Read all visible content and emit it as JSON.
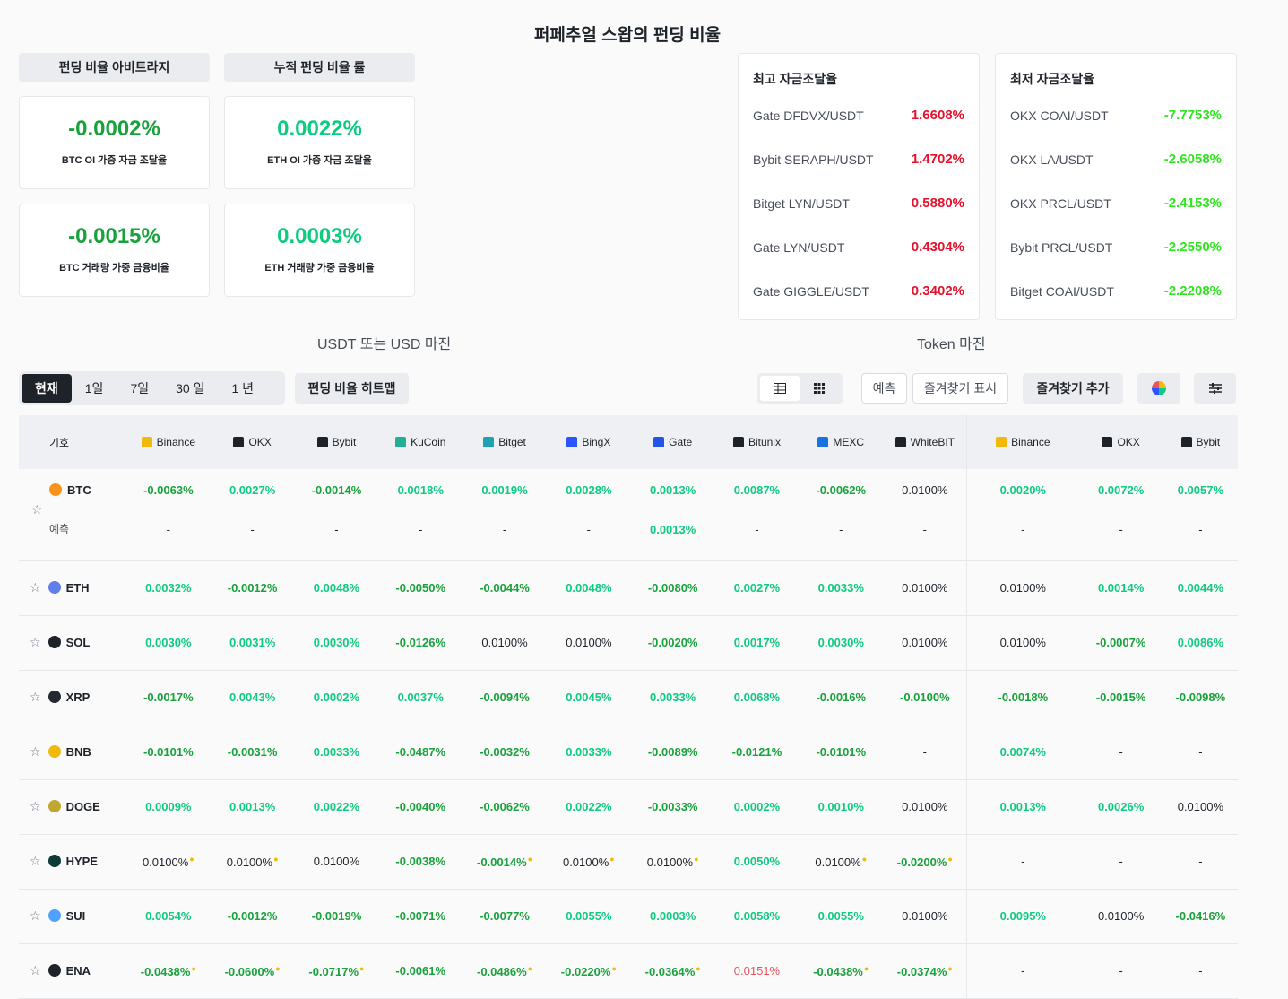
{
  "page_title": "퍼페추얼 스왑의 펀딩 비율",
  "tabs": {
    "arbitrage": "펀딩 비율 아비트라지",
    "cumulative": "누적 펀딩 비율 률"
  },
  "kpis": [
    {
      "value": "-0.0002%",
      "label": "BTC OI 가중 자금 조달율",
      "color": "#18a23c"
    },
    {
      "value": "0.0022%",
      "label": "ETH OI 가중 자금 조달율",
      "color": "#0ecb81"
    },
    {
      "value": "-0.0015%",
      "label": "BTC 거래량 가중 금융비율",
      "color": "#18a23c"
    },
    {
      "value": "0.0003%",
      "label": "ETH 거래량 가중 금융비율",
      "color": "#0ecb81"
    }
  ],
  "highest": {
    "title": "최고 자금조달율",
    "items": [
      {
        "pair": "Gate DFDVX/USDT",
        "value": "1.6608%"
      },
      {
        "pair": "Bybit SERAPH/USDT",
        "value": "1.4702%"
      },
      {
        "pair": "Bitget LYN/USDT",
        "value": "0.5880%"
      },
      {
        "pair": "Gate LYN/USDT",
        "value": "0.4304%"
      },
      {
        "pair": "Gate GIGGLE/USDT",
        "value": "0.3402%"
      }
    ]
  },
  "lowest": {
    "title": "최저 자금조달율",
    "items": [
      {
        "pair": "OKX COAI/USDT",
        "value": "-7.7753%"
      },
      {
        "pair": "OKX LA/USDT",
        "value": "-2.6058%"
      },
      {
        "pair": "OKX PRCL/USDT",
        "value": "-2.4153%"
      },
      {
        "pair": "Bybit PRCL/USDT",
        "value": "-2.2550%"
      },
      {
        "pair": "Bitget COAI/USDT",
        "value": "-2.2208%"
      }
    ]
  },
  "section_labels": {
    "usdt": "USDT 또는 USD 마진",
    "token": "Token 마진"
  },
  "periods": [
    "현재",
    "1일",
    "7일",
    "30 일",
    "1 년"
  ],
  "toolbar": {
    "heatmap": "펀딩 비율 히트맵",
    "predict": "예측",
    "show_fav": "즐겨찾기 표시",
    "add_fav": "즐겨찾기 추가"
  },
  "table": {
    "symbol_header": "기호",
    "exchanges": [
      {
        "name": "Binance",
        "icon": "binance-icon",
        "color": "#f0b90b"
      },
      {
        "name": "OKX",
        "icon": "okx-icon",
        "color": "#1e2329"
      },
      {
        "name": "Bybit",
        "icon": "bybit-icon",
        "color": "#1e2329"
      },
      {
        "name": "KuCoin",
        "icon": "kucoin-icon",
        "color": "#23af91"
      },
      {
        "name": "Bitget",
        "icon": "bitget-icon",
        "color": "#1da2b4"
      },
      {
        "name": "BingX",
        "icon": "bingx-icon",
        "color": "#2a54ff"
      },
      {
        "name": "Gate",
        "icon": "gate-icon",
        "color": "#2354e6"
      },
      {
        "name": "Bitunix",
        "icon": "bitunix-icon",
        "color": "#1e2329"
      },
      {
        "name": "MEXC",
        "icon": "mexc-icon",
        "color": "#1972e2"
      },
      {
        "name": "WhiteBIT",
        "icon": "whitebit-icon",
        "color": "#1e2329"
      },
      {
        "name": "Binance",
        "icon": "binance-icon",
        "color": "#f0b90b"
      },
      {
        "name": "OKX",
        "icon": "okx-icon",
        "color": "#1e2329"
      },
      {
        "name": "Bybit",
        "icon": "bybit-icon",
        "color": "#1e2329"
      }
    ],
    "predict_label": "예측",
    "btc_predict": [
      "-",
      "-",
      "-",
      "-",
      "-",
      "-",
      "0.0013%",
      "-",
      "-",
      "-",
      "-",
      "-",
      "-"
    ],
    "rows": [
      {
        "symbol": "BTC",
        "icon_color": "#f7931a",
        "values": [
          "-0.0063%",
          "0.0027%",
          "-0.0014%",
          "0.0018%",
          "0.0019%",
          "0.0028%",
          "0.0013%",
          "0.0087%",
          "-0.0062%",
          "0.0100%",
          "0.0020%",
          "0.0072%",
          "0.0057%"
        ],
        "dots": []
      },
      {
        "symbol": "ETH",
        "icon_color": "#627eea",
        "values": [
          "0.0032%",
          "-0.0012%",
          "0.0048%",
          "-0.0050%",
          "-0.0044%",
          "0.0048%",
          "-0.0080%",
          "0.0027%",
          "0.0033%",
          "0.0100%",
          "0.0100%",
          "0.0014%",
          "0.0044%"
        ],
        "dots": []
      },
      {
        "symbol": "SOL",
        "icon_color": "#1e2329",
        "values": [
          "0.0030%",
          "0.0031%",
          "0.0030%",
          "-0.0126%",
          "0.0100%",
          "0.0100%",
          "-0.0020%",
          "0.0017%",
          "0.0030%",
          "0.0100%",
          "0.0100%",
          "-0.0007%",
          "0.0086%"
        ],
        "dots": []
      },
      {
        "symbol": "XRP",
        "icon_color": "#23292f",
        "values": [
          "-0.0017%",
          "0.0043%",
          "0.0002%",
          "0.0037%",
          "-0.0094%",
          "0.0045%",
          "0.0033%",
          "0.0068%",
          "-0.0016%",
          "-0.0100%",
          "-0.0018%",
          "-0.0015%",
          "-0.0098%"
        ],
        "dots": []
      },
      {
        "symbol": "BNB",
        "icon_color": "#f0b90b",
        "values": [
          "-0.0101%",
          "-0.0031%",
          "0.0033%",
          "-0.0487%",
          "-0.0032%",
          "0.0033%",
          "-0.0089%",
          "-0.0121%",
          "-0.0101%",
          "-",
          "0.0074%",
          "-",
          "-"
        ],
        "dots": []
      },
      {
        "symbol": "DOGE",
        "icon_color": "#c2a633",
        "values": [
          "0.0009%",
          "0.0013%",
          "0.0022%",
          "-0.0040%",
          "-0.0062%",
          "0.0022%",
          "-0.0033%",
          "0.0002%",
          "0.0010%",
          "0.0100%",
          "0.0013%",
          "0.0026%",
          "0.0100%"
        ],
        "dots": []
      },
      {
        "symbol": "HYPE",
        "icon_color": "#0e3b36",
        "values": [
          "0.0100%",
          "0.0100%",
          "0.0100%",
          "-0.0038%",
          "-0.0014%",
          "0.0100%",
          "0.0100%",
          "0.0050%",
          "0.0100%",
          "-0.0200%",
          "-",
          "-",
          "-"
        ],
        "dots": [
          0,
          1,
          4,
          5,
          6,
          8,
          9
        ]
      },
      {
        "symbol": "SUI",
        "icon_color": "#4da2ff",
        "values": [
          "0.0054%",
          "-0.0012%",
          "-0.0019%",
          "-0.0071%",
          "-0.0077%",
          "0.0055%",
          "0.0003%",
          "0.0058%",
          "0.0055%",
          "0.0100%",
          "0.0095%",
          "0.0100%",
          "-0.0416%"
        ],
        "dots": []
      },
      {
        "symbol": "ENA",
        "icon_color": "#1e2329",
        "values": [
          "-0.0438%",
          "-0.0600%",
          "-0.0717%",
          "-0.0061%",
          "-0.0486%",
          "-0.0220%",
          "-0.0364%",
          "0.0151%",
          "-0.0438%",
          "-0.0374%",
          "-",
          "-",
          "-"
        ],
        "dots": [
          0,
          1,
          2,
          4,
          5,
          6,
          8,
          9
        ]
      }
    ]
  }
}
